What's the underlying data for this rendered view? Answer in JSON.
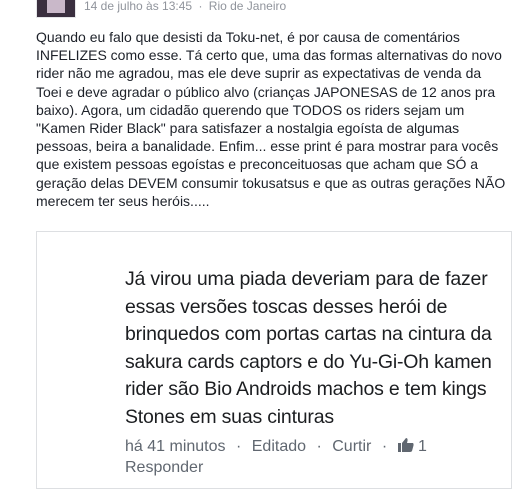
{
  "post": {
    "timestamp": "14 de julho às 13:45",
    "separator": "·",
    "location": "Rio de Janeiro",
    "body": "Quando eu falo que desisti da Toku-net, é por causa de comentários INFELIZES como esse. Tá certo que, uma das formas alternativas do novo rider não me agradou, mas ele deve suprir as expectativas de venda da Toei e deve agradar o público alvo (crianças JAPONESAS de 12 anos pra baixo). Agora, um cidadão querendo que TODOS os riders sejam um \"Kamen Rider Black\" para satisfazer a nostalgia egoísta de algumas pessoas, beira a banalidade. Enfim... esse print é para mostrar para vocês que existem pessoas egoístas e preconceituosas que acham que SÓ a geração delas DEVEM consumir tokusatsus e que as outras gerações NÃO merecem ter seus heróis....."
  },
  "shared_comment": {
    "text": "Já virou uma piada deveriam para de fazer essas versões toscas desses herói de brinquedos com portas cartas na cintura da sakura cards captors e do Yu-Gi-Oh kamen rider são Bio Androids machos e tem  kings Stones em suas cinturas",
    "time": "há 41 minutos",
    "edited": "Editado",
    "like": "Curtir",
    "like_count": "1",
    "reply": "Responder",
    "dot": "·"
  }
}
